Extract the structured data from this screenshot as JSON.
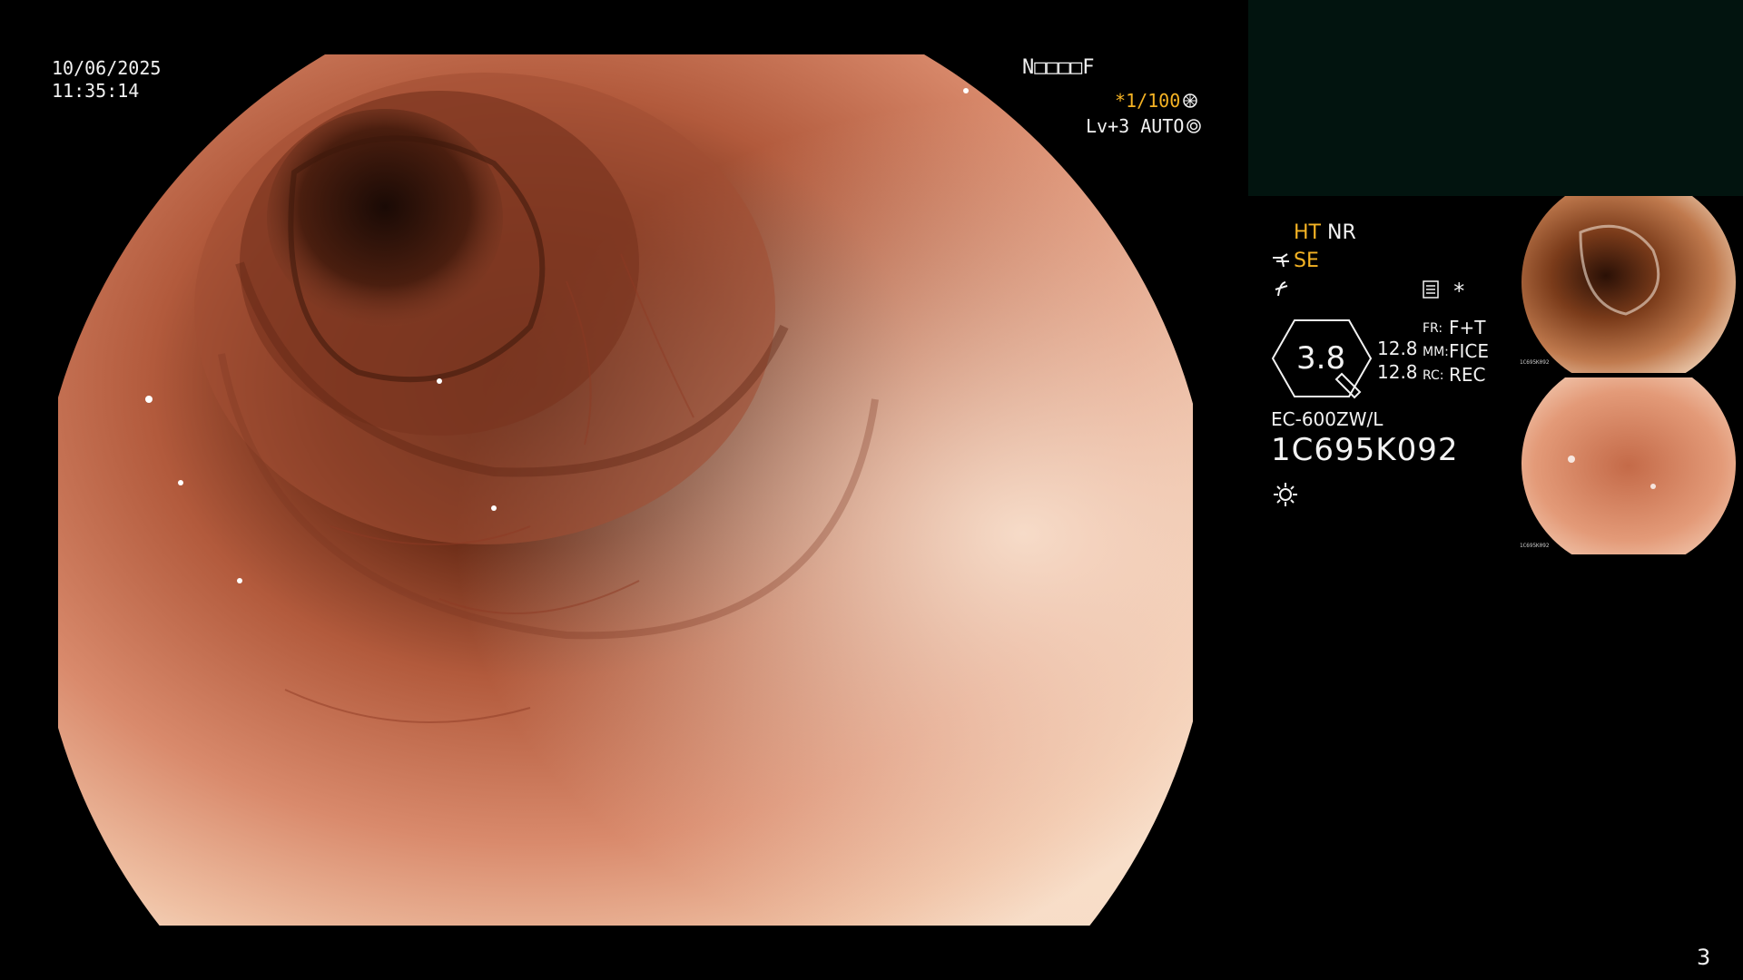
{
  "datetime": {
    "date": "10/06/2025",
    "time": "11:35:14"
  },
  "overlay": {
    "mode_code": "N□□□□F",
    "shutter": "*1/100",
    "level": "Lv+3 AUTO"
  },
  "settings": {
    "ht": "HT",
    "nr": "NR",
    "se": "SE",
    "zoom_value": "3.8",
    "value_1": "12.8",
    "value_2": "12.8",
    "fr_label": "FR:",
    "fr_value": "F+T",
    "mm_label": "MM:",
    "mm_value": "FICE",
    "rc_label": "RC:",
    "rc_value": "REC",
    "asterisk": "*"
  },
  "scope": {
    "model": "EC-600ZW/L",
    "serial": "1C695K092"
  },
  "thumbnails": [
    {
      "caption_line1": "1C695K092"
    },
    {
      "caption_line1": "1C695K092"
    }
  ],
  "page_number": "3",
  "colors": {
    "accent_orange": "#f5b324",
    "panel_dark": "#02140f",
    "background": "#000000"
  },
  "icons": {
    "shutter": "aperture-icon",
    "level": "iris-icon",
    "scope_tip": "scope-tip-icon",
    "light": "light-sun-icon",
    "memo": "memo-icon"
  }
}
